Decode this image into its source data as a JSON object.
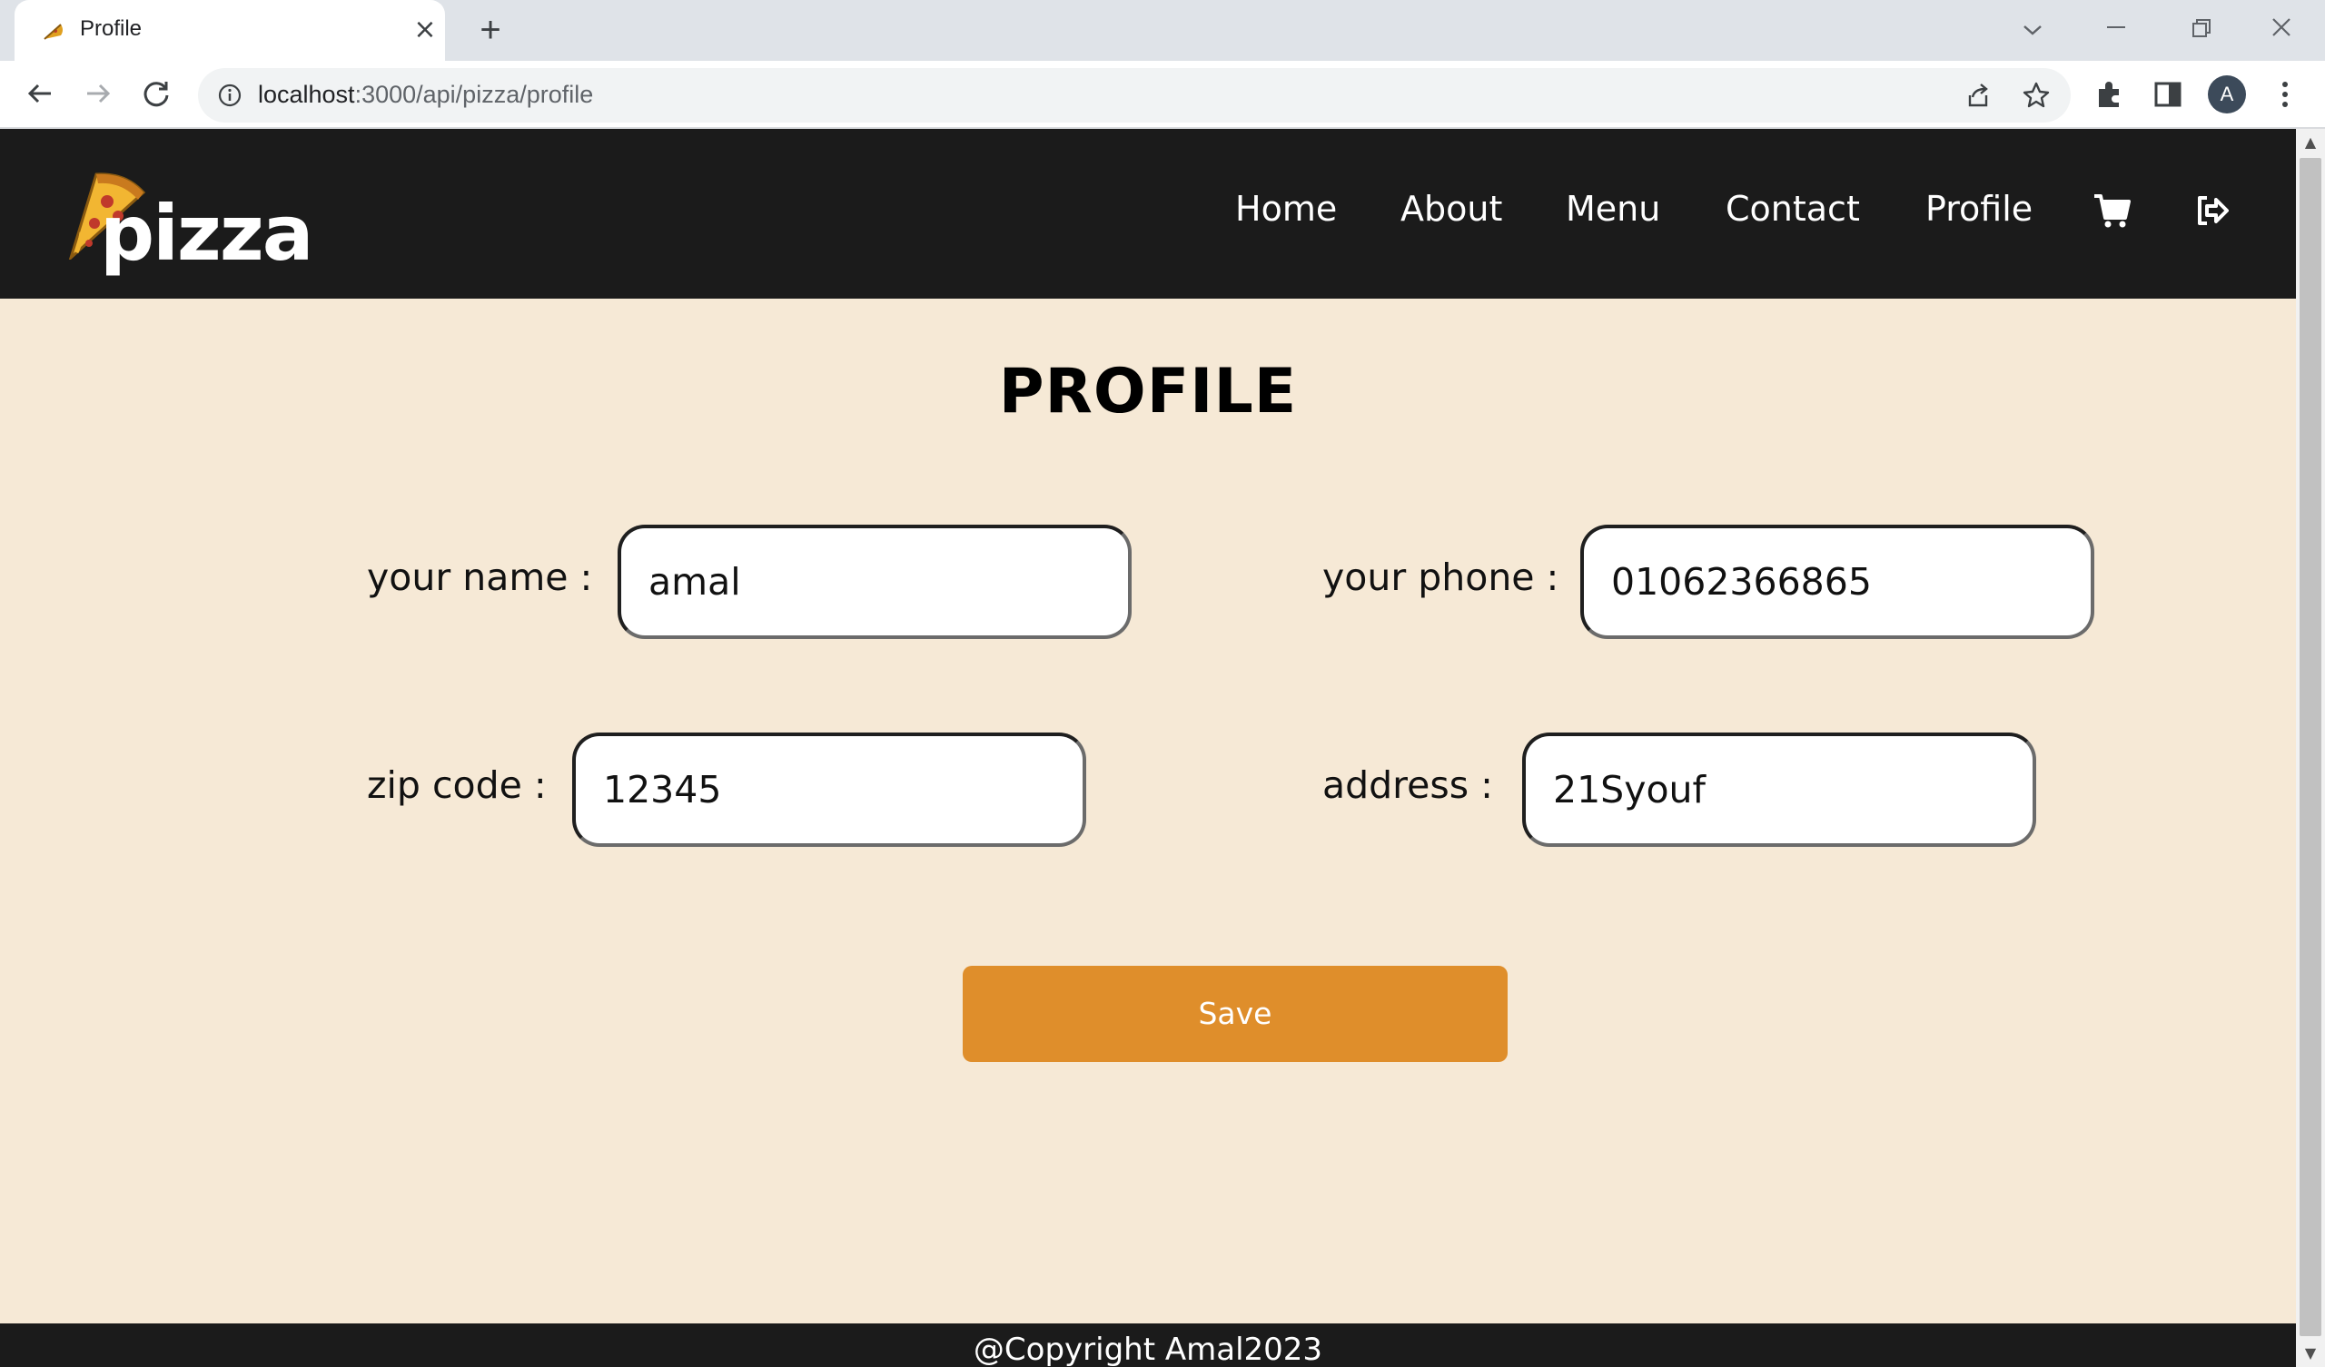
{
  "browser": {
    "tab_title": "Profile",
    "url_host": "localhost",
    "url_rest": ":3000/api/pizza/profile",
    "avatar_letter": "A"
  },
  "site": {
    "logo_text": "pizza",
    "nav": [
      "Home",
      "About",
      "Menu",
      "Contact",
      "Profile"
    ],
    "nav_icons": [
      "cart-icon",
      "logout-icon"
    ]
  },
  "profile": {
    "title": "PROFILE",
    "name_label": "your name :",
    "name_value": "amal",
    "phone_label": "your phone :",
    "phone_value": "01062366865",
    "zip_label": "zip code :",
    "zip_value": "12345",
    "address_label": "address :",
    "address_value": "21Syouf",
    "save_label": "Save"
  },
  "footer": {
    "text": "@Copyright Amal2023"
  },
  "colors": {
    "background": "#f6e9d6",
    "header": "#1b1b1b",
    "accent": "#df8e2b"
  }
}
